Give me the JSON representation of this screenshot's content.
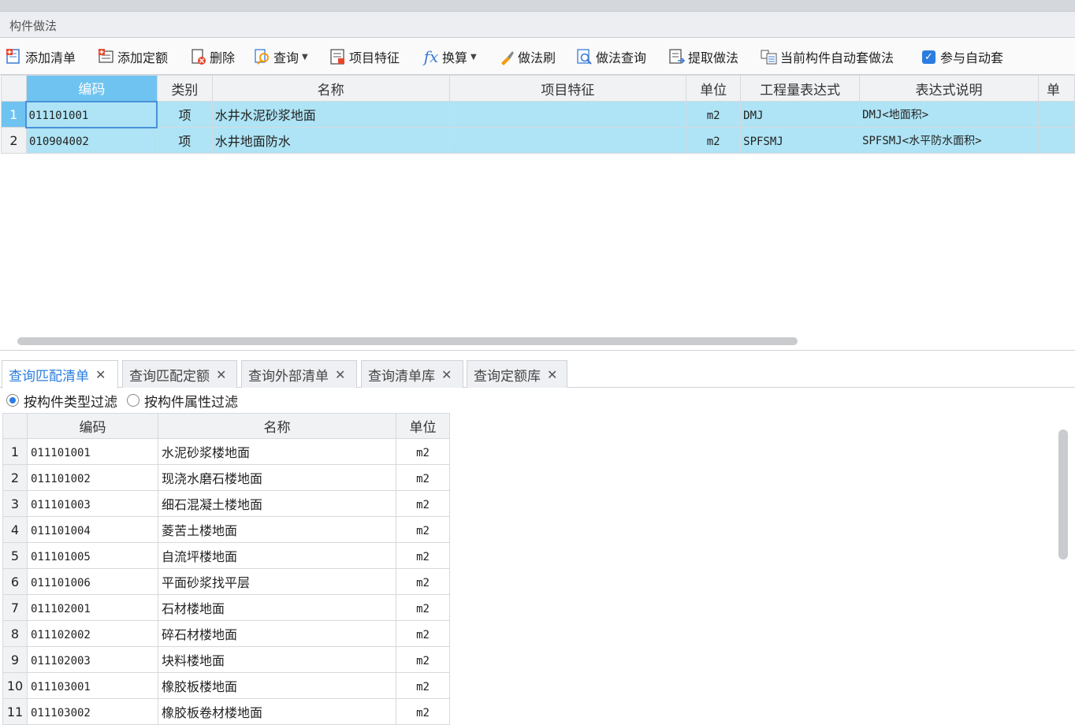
{
  "panel": {
    "title": "构件做法"
  },
  "toolbar": {
    "add_list": "添加清单",
    "add_quota": "添加定额",
    "delete": "删除",
    "query": "查询",
    "item_feature": "项目特征",
    "convert": "换算",
    "method_brush": "做法刷",
    "method_query": "做法查询",
    "extract_method": "提取做法",
    "auto_apply": "当前构件自动套做法",
    "participate_auto": "参与自动套"
  },
  "upper_grid": {
    "headers": [
      "编码",
      "类别",
      "名称",
      "项目特征",
      "单位",
      "工程量表达式",
      "表达式说明",
      "单"
    ],
    "rows": [
      {
        "num": "1",
        "code": "011101001",
        "type": "项",
        "name": "水井水泥砂浆地面",
        "feature": "",
        "unit": "m2",
        "expr": "DMJ",
        "desc": "DMJ<地面积>"
      },
      {
        "num": "2",
        "code": "010904002",
        "type": "项",
        "name": "水井地面防水",
        "feature": "",
        "unit": "m2",
        "expr": "SPFSMJ",
        "desc": "SPFSMJ<水平防水面积>"
      }
    ]
  },
  "tabs": [
    "查询匹配清单",
    "查询匹配定额",
    "查询外部清单",
    "查询清单库",
    "查询定额库"
  ],
  "filter": {
    "by_type": "按构件类型过滤",
    "by_attr": "按构件属性过滤"
  },
  "lower_grid": {
    "headers": [
      "编码",
      "名称",
      "单位"
    ],
    "rows": [
      {
        "num": "1",
        "code": "011101001",
        "name": "水泥砂浆楼地面",
        "unit": "m2"
      },
      {
        "num": "2",
        "code": "011101002",
        "name": "现浇水磨石楼地面",
        "unit": "m2"
      },
      {
        "num": "3",
        "code": "011101003",
        "name": "细石混凝土楼地面",
        "unit": "m2"
      },
      {
        "num": "4",
        "code": "011101004",
        "name": "菱苦土楼地面",
        "unit": "m2"
      },
      {
        "num": "5",
        "code": "011101005",
        "name": "自流坪楼地面",
        "unit": "m2"
      },
      {
        "num": "6",
        "code": "011101006",
        "name": "平面砂浆找平层",
        "unit": "m2"
      },
      {
        "num": "7",
        "code": "011102001",
        "name": "石材楼地面",
        "unit": "m2"
      },
      {
        "num": "8",
        "code": "011102002",
        "name": "碎石材楼地面",
        "unit": "m2"
      },
      {
        "num": "9",
        "code": "011102003",
        "name": "块料楼地面",
        "unit": "m2"
      },
      {
        "num": "10",
        "code": "011103001",
        "name": "橡胶板楼地面",
        "unit": "m2"
      },
      {
        "num": "11",
        "code": "011103002",
        "name": "橡胶板卷材楼地面",
        "unit": "m2"
      }
    ]
  },
  "colors": {
    "selected_row": "#aee4f5",
    "selected_header": "#6fc3f0",
    "accent": "#2b7de0"
  }
}
